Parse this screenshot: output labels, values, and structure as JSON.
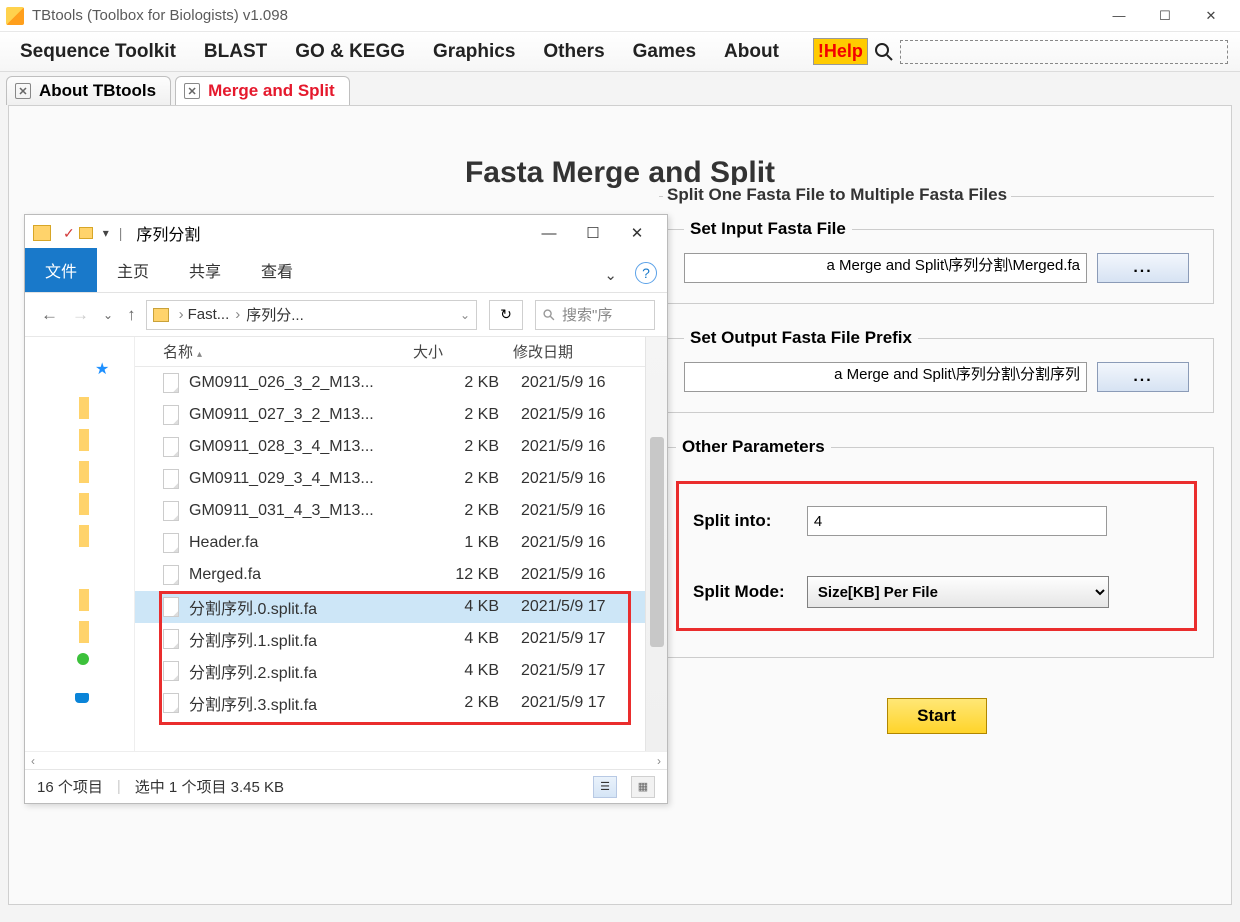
{
  "window": {
    "title": "TBtools (Toolbox for Biologists) v1.098"
  },
  "menus": [
    "Sequence Toolkit",
    "BLAST",
    "GO & KEGG",
    "Graphics",
    "Others",
    "Games",
    "About"
  ],
  "help_button": "!Help",
  "tabs": [
    {
      "label": "About TBtools",
      "active": false
    },
    {
      "label": "Merge and Split",
      "active": true
    }
  ],
  "heading": "Fasta Merge and Split",
  "right_section_title": "Split One Fasta File to Multiple Fasta Files",
  "fieldset_input": {
    "legend": "Set Input Fasta File",
    "value": "a Merge and Split\\序列分割\\Merged.fa",
    "browse": "..."
  },
  "fieldset_output": {
    "legend": "Set Output Fasta File Prefix",
    "value": "a Merge and Split\\序列分割\\分割序列",
    "browse": "..."
  },
  "params": {
    "legend": "Other Parameters",
    "split_into_label": "Split into:",
    "split_into_value": "4",
    "split_mode_label": "Split Mode:",
    "split_mode_value": "Size[KB] Per File"
  },
  "start_button": "Start",
  "explorer": {
    "folder_name": "序列分割",
    "ribbon_tabs": [
      "文件",
      "主页",
      "共享",
      "查看"
    ],
    "breadcrumb": [
      "Fast...",
      "序列分..."
    ],
    "search_placeholder": "搜索\"序",
    "columns": {
      "name": "名称",
      "size": "大小",
      "date": "修改日期"
    },
    "files": [
      {
        "name": "GM0911_026_3_2_M13...",
        "size": "2 KB",
        "date": "2021/5/9 16"
      },
      {
        "name": "GM0911_027_3_2_M13...",
        "size": "2 KB",
        "date": "2021/5/9 16"
      },
      {
        "name": "GM0911_028_3_4_M13...",
        "size": "2 KB",
        "date": "2021/5/9 16"
      },
      {
        "name": "GM0911_029_3_4_M13...",
        "size": "2 KB",
        "date": "2021/5/9 16"
      },
      {
        "name": "GM0911_031_4_3_M13...",
        "size": "2 KB",
        "date": "2021/5/9 16"
      },
      {
        "name": "Header.fa",
        "size": "1 KB",
        "date": "2021/5/9 16"
      },
      {
        "name": "Merged.fa",
        "size": "12 KB",
        "date": "2021/5/9 16"
      },
      {
        "name": "分割序列.0.split.fa",
        "size": "4 KB",
        "date": "2021/5/9 17",
        "selected": true
      },
      {
        "name": "分割序列.1.split.fa",
        "size": "4 KB",
        "date": "2021/5/9 17"
      },
      {
        "name": "分割序列.2.split.fa",
        "size": "4 KB",
        "date": "2021/5/9 17"
      },
      {
        "name": "分割序列.3.split.fa",
        "size": "2 KB",
        "date": "2021/5/9 17"
      }
    ],
    "status": {
      "count": "16 个项目",
      "selected": "选中 1 个项目  3.45 KB"
    }
  }
}
